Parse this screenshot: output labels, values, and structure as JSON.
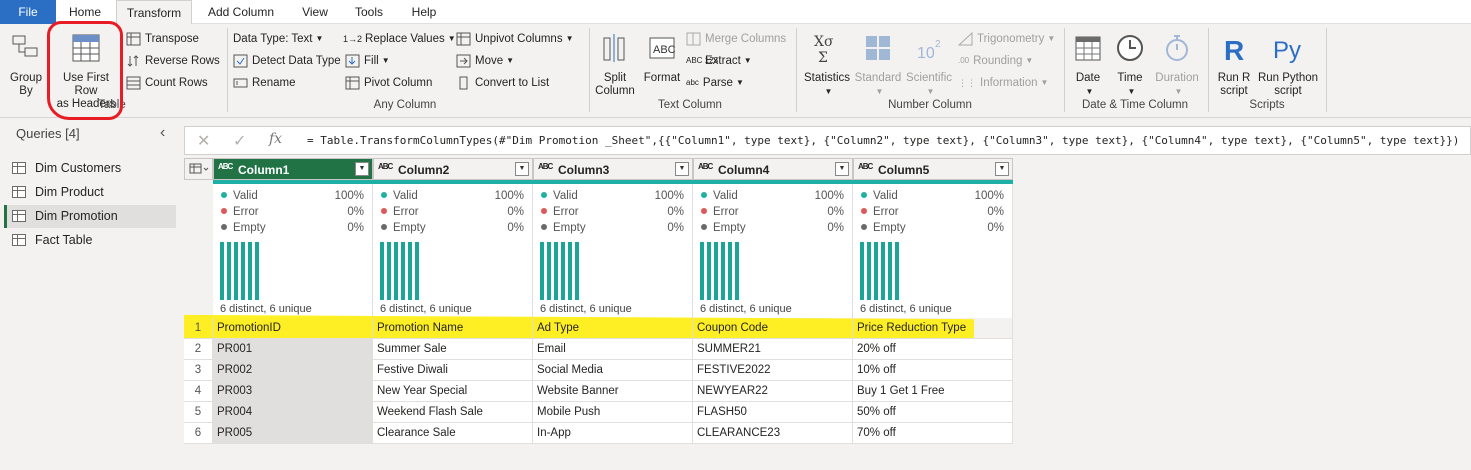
{
  "tabs": [
    "File",
    "Home",
    "Transform",
    "Add Column",
    "View",
    "Tools",
    "Help"
  ],
  "ribbon": {
    "table": {
      "group_by": "Group\nBy",
      "use_first_row": "Use First Row\nas Headers",
      "transpose": "Transpose",
      "reverse_rows": "Reverse Rows",
      "count_rows": "Count Rows",
      "label": "Table"
    },
    "any_column": {
      "data_type": "Data Type: Text",
      "detect_type": "Detect Data Type",
      "rename": "Rename",
      "replace_values": "Replace Values",
      "fill": "Fill",
      "pivot": "Pivot Column",
      "unpivot": "Unpivot Columns",
      "move": "Move",
      "convert": "Convert to List",
      "label": "Any Column"
    },
    "text_column": {
      "split": "Split\nColumn",
      "format": "Format",
      "merge": "Merge Columns",
      "extract": "Extract",
      "parse": "Parse",
      "label": "Text Column"
    },
    "number_column": {
      "statistics": "Statistics",
      "standard": "Standard",
      "scientific": "Scientific",
      "trig": "Trigonometry",
      "rounding": "Rounding",
      "information": "Information",
      "label": "Number Column"
    },
    "datetime": {
      "date": "Date",
      "time": "Time",
      "duration": "Duration",
      "label": "Date & Time Column"
    },
    "scripts": {
      "run_r": "Run R\nscript",
      "run_py": "Run Python\nscript",
      "label": "Scripts"
    }
  },
  "formula": "= Table.TransformColumnTypes(#\"Dim Promotion _Sheet\",{{\"Column1\", type text}, {\"Column2\", type text}, {\"Column3\", type text}, {\"Column4\", type text}, {\"Column5\", type text}})",
  "queries": {
    "title": "Queries [4]",
    "items": [
      "Dim Customers",
      "Dim Product",
      "Dim Promotion",
      "Fact Table"
    ]
  },
  "columns": [
    "Column1",
    "Column2",
    "Column3",
    "Column4",
    "Column5"
  ],
  "profile": {
    "valid": "Valid",
    "error": "Error",
    "empty": "Empty",
    "valid_pct": "100%",
    "error_pct": "0%",
    "empty_pct": "0%",
    "distinct": "6 distinct, 6 unique"
  },
  "rows": [
    [
      "1",
      "PromotionID",
      "Promotion Name",
      "Ad Type",
      "Coupon Code",
      "Price Reduction Type"
    ],
    [
      "2",
      "PR001",
      "Summer Sale",
      "Email",
      "SUMMER21",
      "20% off"
    ],
    [
      "3",
      "PR002",
      "Festive Diwali",
      "Social Media",
      "FESTIVE2022",
      "10% off"
    ],
    [
      "4",
      "PR003",
      "New Year Special",
      "Website Banner",
      "NEWYEAR22",
      "Buy 1 Get 1 Free"
    ],
    [
      "5",
      "PR004",
      "Weekend Flash Sale",
      "Mobile Push",
      "FLASH50",
      "50% off"
    ],
    [
      "6",
      "PR005",
      "Clearance Sale",
      "In-App",
      "CLEARANCE23",
      "70% off"
    ]
  ]
}
